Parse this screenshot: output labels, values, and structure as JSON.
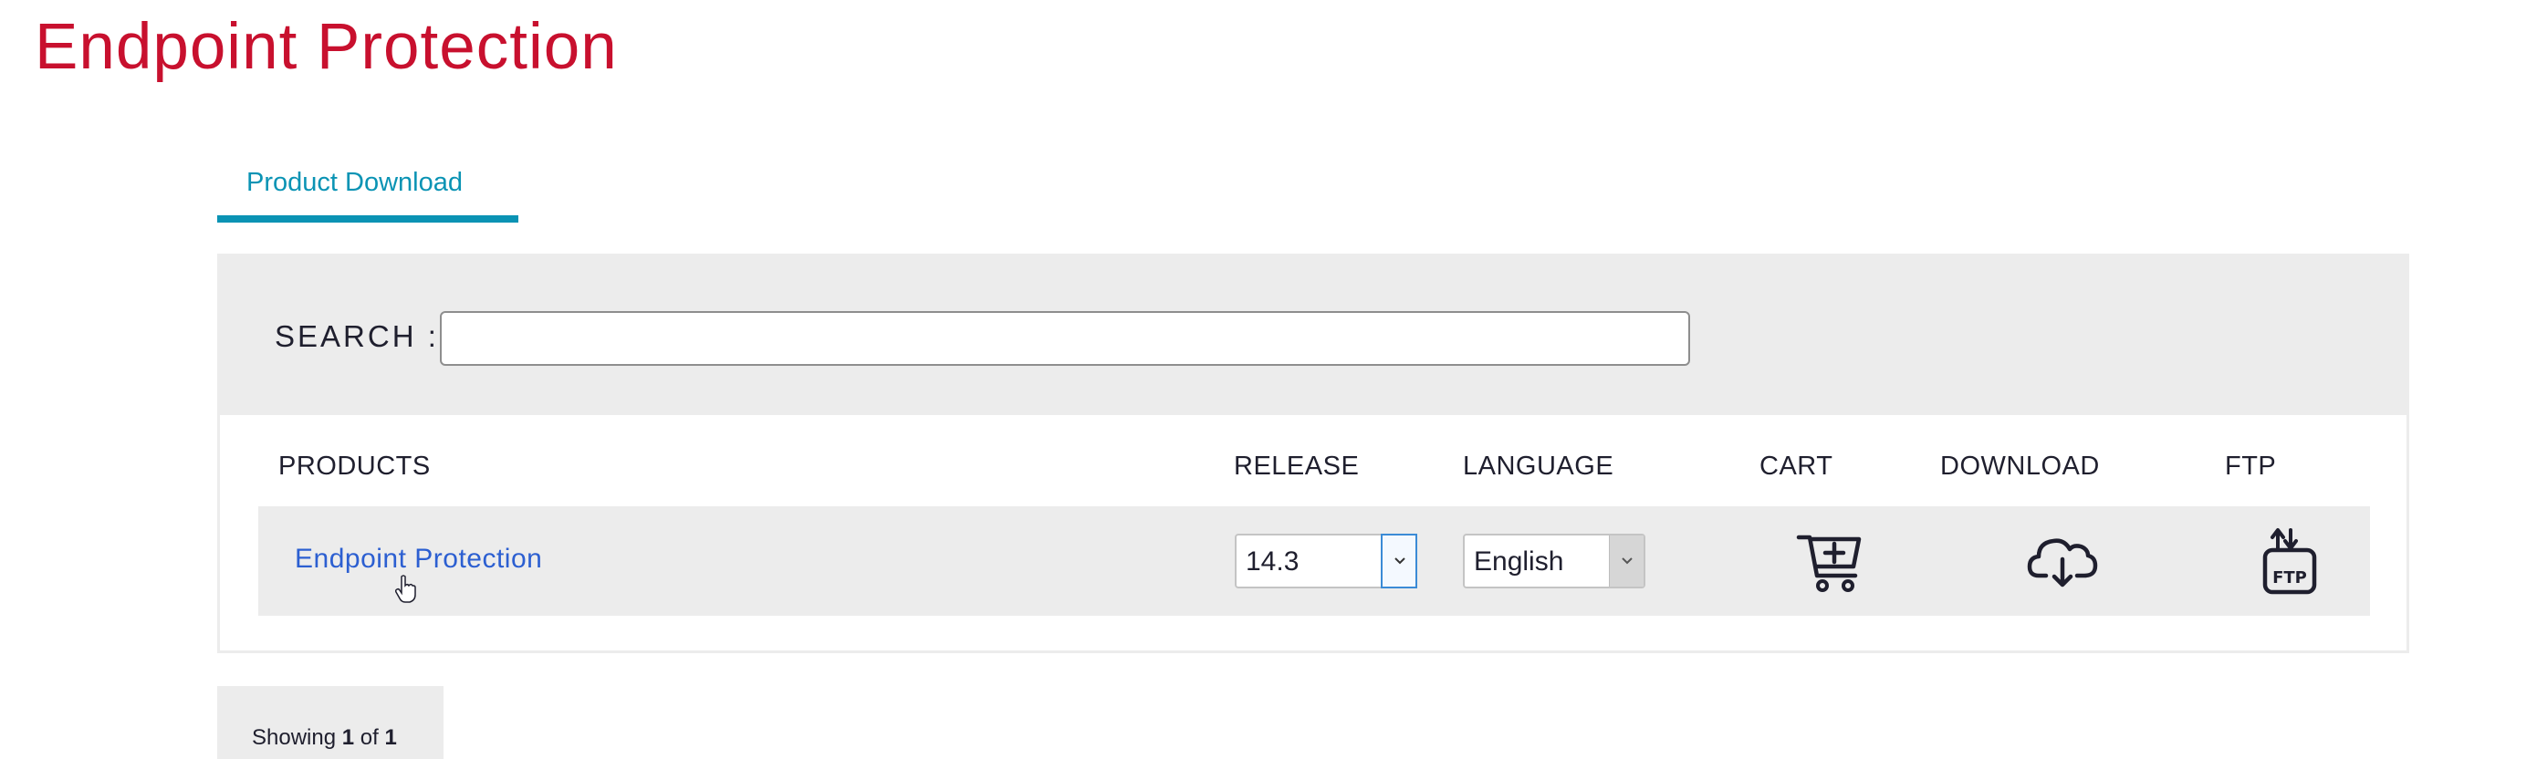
{
  "page": {
    "title": "Endpoint Protection"
  },
  "tabs": [
    {
      "label": "Product Download",
      "active": true
    }
  ],
  "search": {
    "label": "SEARCH :",
    "value": "",
    "placeholder": ""
  },
  "table": {
    "columns": [
      "PRODUCTS",
      "RELEASE",
      "LANGUAGE",
      "CART",
      "DOWNLOAD",
      "FTP"
    ],
    "rows": [
      {
        "product": "Endpoint Protection",
        "release": "14.3",
        "language": "English",
        "cart_icon": "cart-add-icon",
        "download_icon": "cloud-download-icon",
        "ftp_icon": "ftp-icon",
        "ftp_icon_text": "FTP"
      }
    ]
  },
  "pagination": {
    "prefix": "Showing ",
    "current": "1",
    "of": " of ",
    "total": "1"
  },
  "colors": {
    "title": "#c8102e",
    "tab_accent": "#0a93b4",
    "link": "#2c5fd1",
    "panel_bg": "#ececec"
  }
}
